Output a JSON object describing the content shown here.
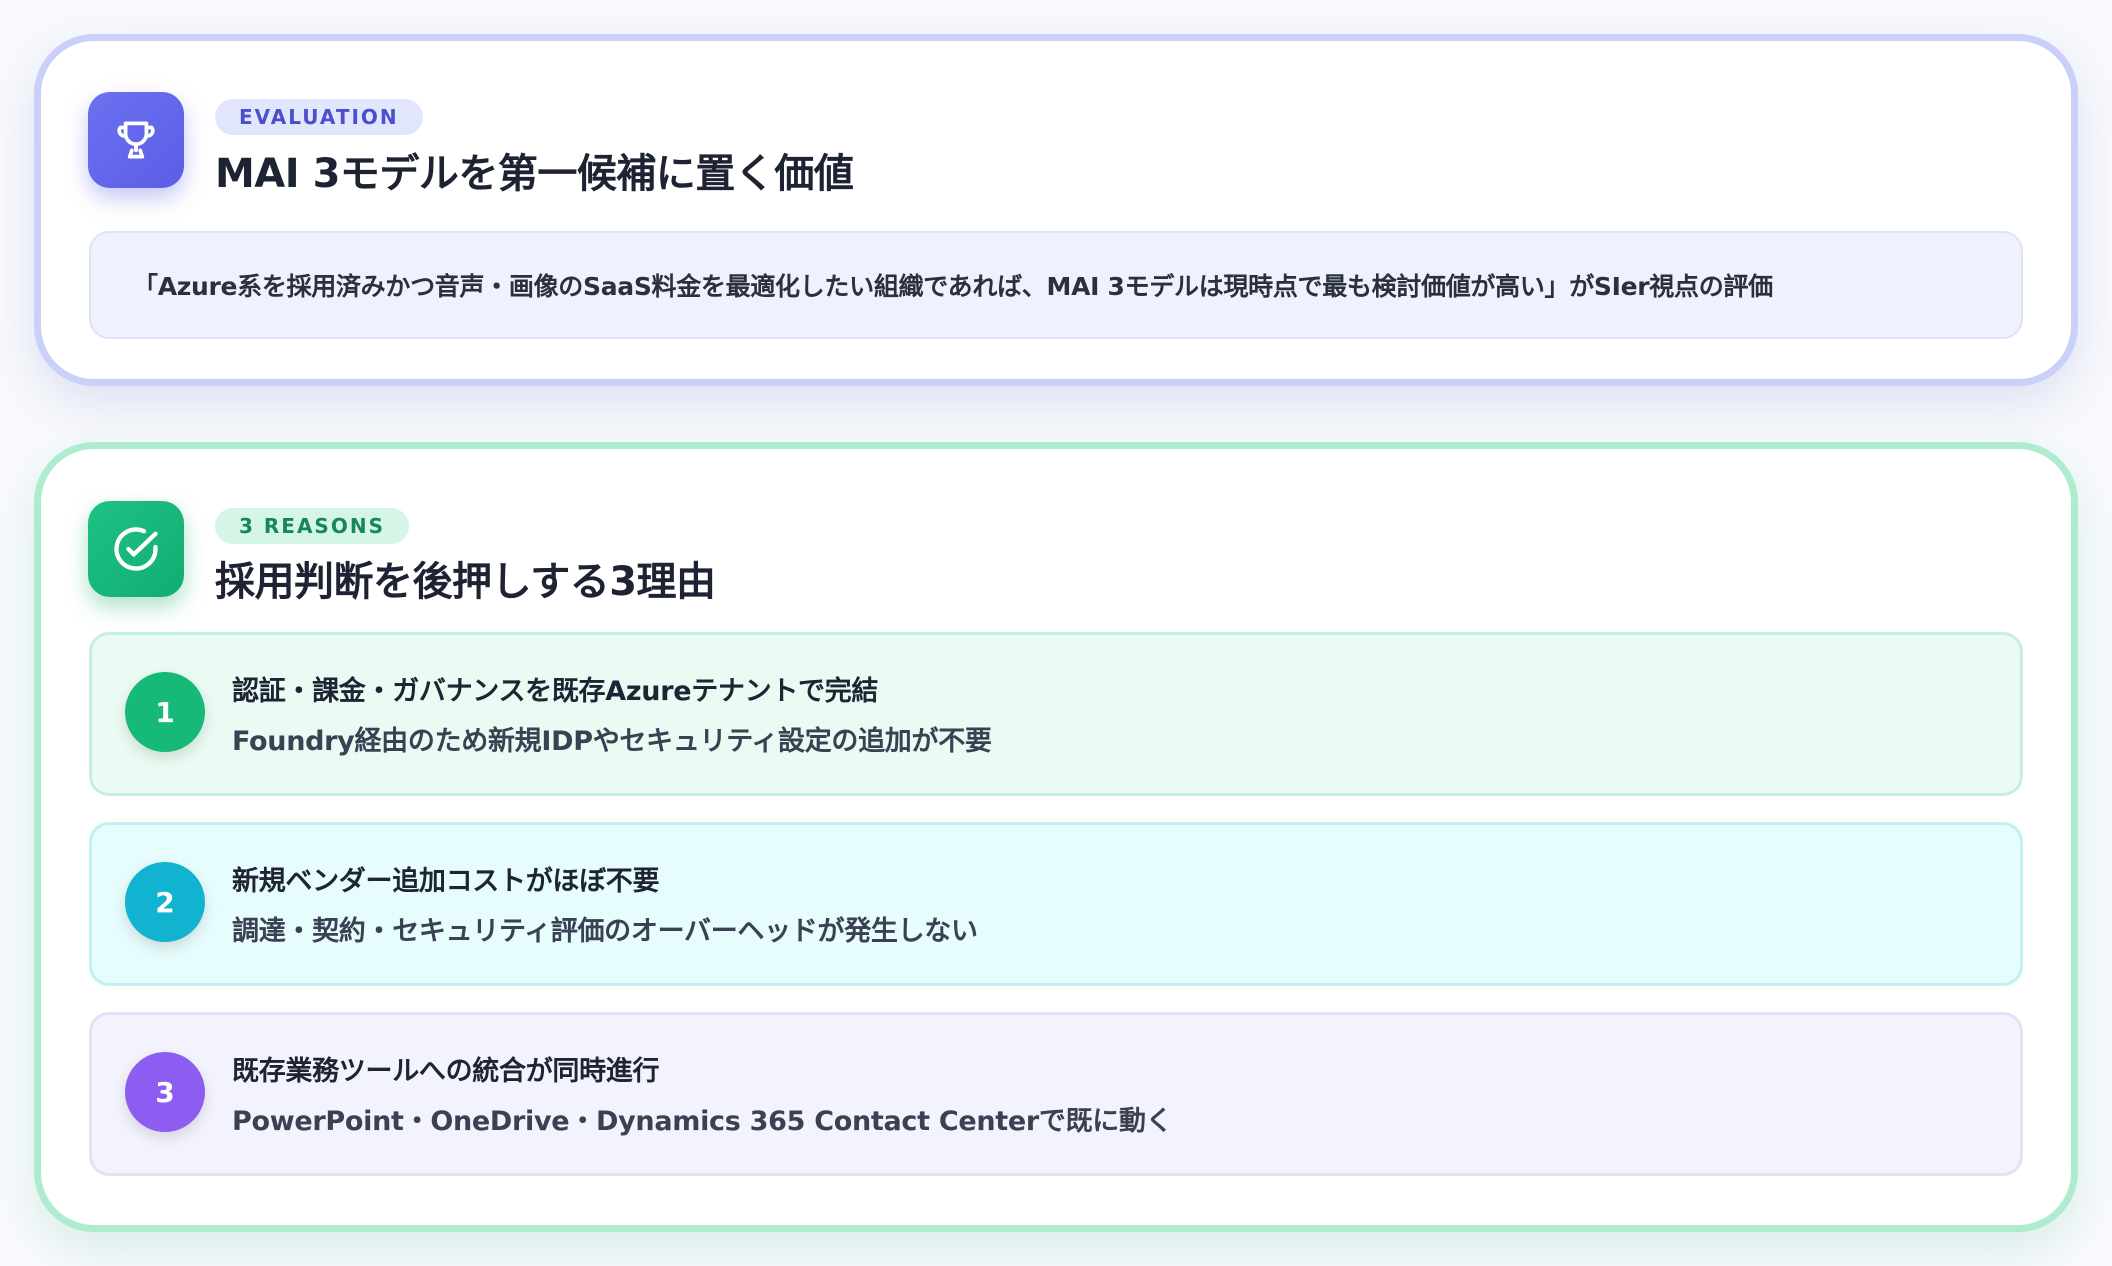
{
  "evaluation": {
    "badge": "EVALUATION",
    "title": "MAI 3モデルを第一候補に置く価値",
    "quote": "「Azure系を採用済みかつ音声・画像のSaaS料金を最適化したい組織であれば、MAI 3モデルは現時点で最も検討価値が高い」がSIer視点の評価",
    "icon": "trophy-icon",
    "accent": "#5b5ee6"
  },
  "reasons": {
    "badge": "3 REASONS",
    "title": "採用判断を後押しする3理由",
    "icon": "check-circle-icon",
    "accent": "#11ad72",
    "items": [
      {
        "number": "1",
        "title": "認証・課金・ガバナンスを既存Azureテナントで完結",
        "description": "Foundry経由のため新規IDPやセキュリティ設定の追加が不要",
        "color": "#16b978"
      },
      {
        "number": "2",
        "title": "新規ベンダー追加コストがほぼ不要",
        "description": "調達・契約・セキュリティ評価のオーバーヘッドが発生しない",
        "color": "#12b3d1"
      },
      {
        "number": "3",
        "title": "既存業務ツールへの統合が同時進行",
        "description": "PowerPoint・OneDrive・Dynamics 365 Contact Centerで既に動く",
        "color": "#8c5df0"
      }
    ]
  }
}
